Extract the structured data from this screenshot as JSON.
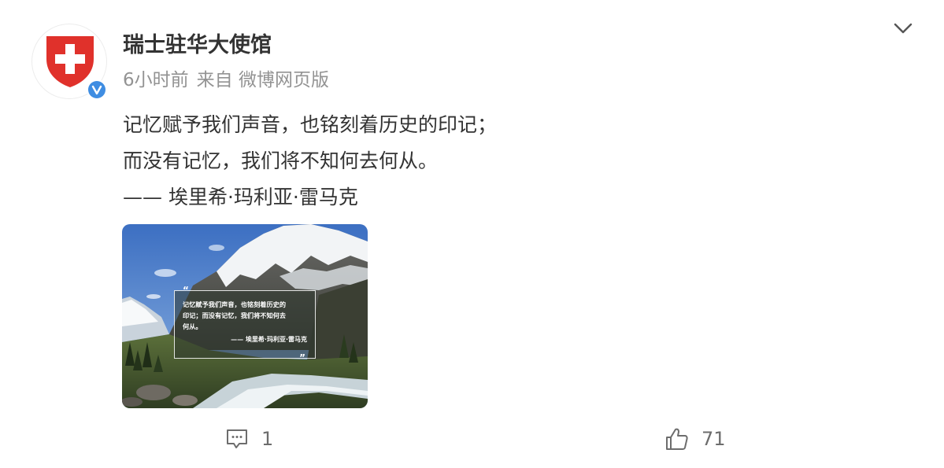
{
  "post": {
    "author": "瑞士驻华大使馆",
    "time": "6小时前",
    "source": "来自 微博网页版",
    "lines": [
      "记忆赋予我们声音，也铭刻着历史的印记；",
      "而没有记忆，我们将不知何去何从。",
      "—— 埃里希·玛利亚·雷马克"
    ],
    "image_quote": {
      "line1": "记忆赋予我们声音，也铭刻着历史的",
      "line2": "印记；而没有记忆，我们将不知何去",
      "line3": "何从。",
      "author": "—— 埃里希·玛利亚·雷马克"
    }
  },
  "actions": {
    "comments": "1",
    "likes": "71"
  },
  "icons": {
    "avatar": "swiss-flag-shield-icon",
    "verified": "verified-badge-icon",
    "menu": "chevron-down-icon",
    "comment": "comment-icon",
    "like": "thumbs-up-icon"
  },
  "colors": {
    "swiss_red": "#e0312b",
    "verified_blue": "#3f8de2",
    "meta_gray": "#939393"
  }
}
